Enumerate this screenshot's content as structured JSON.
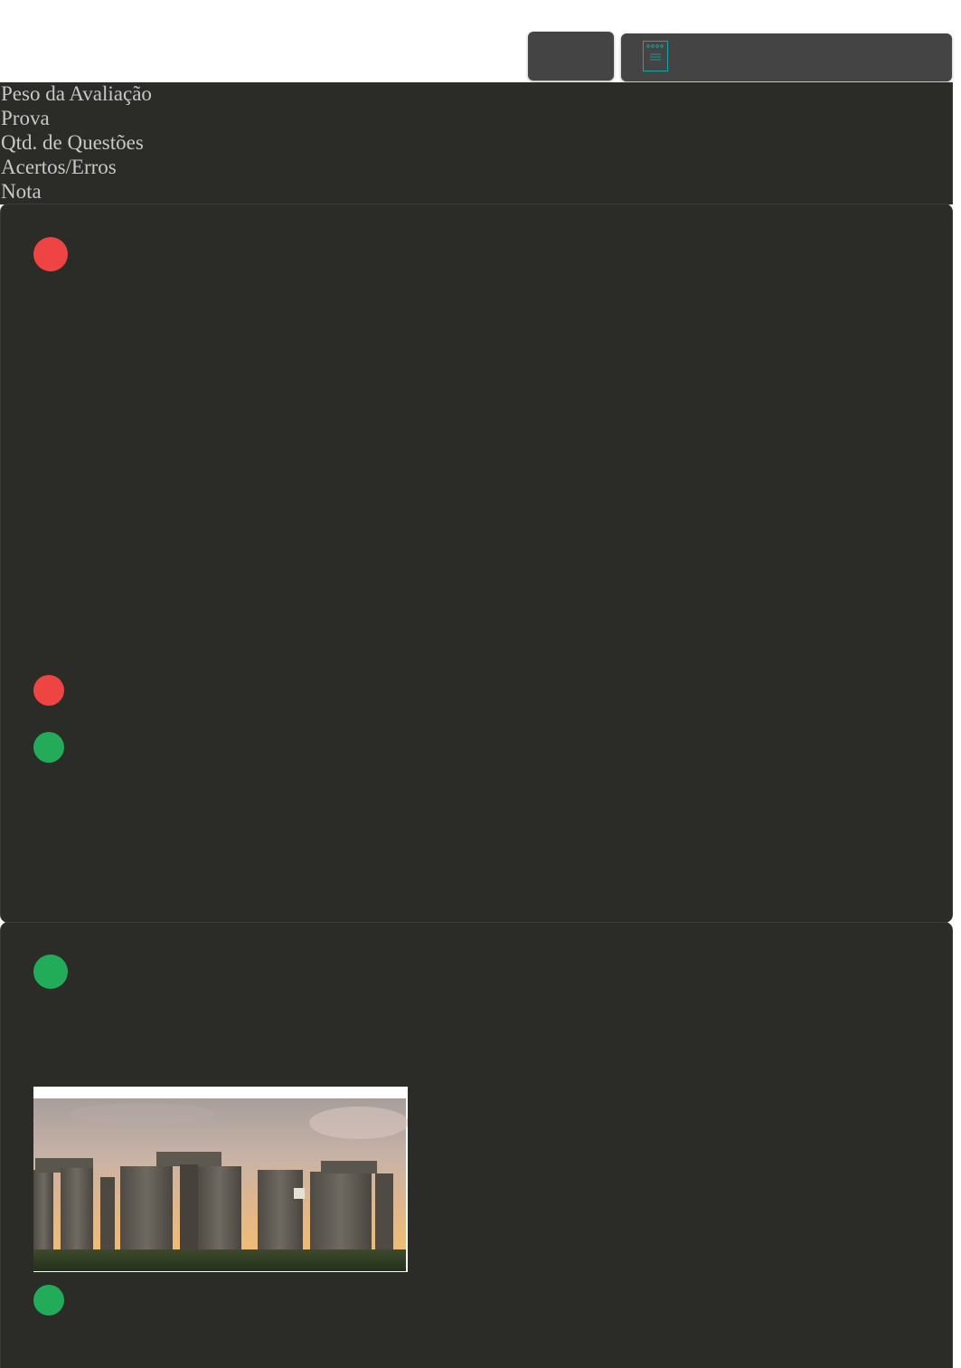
{
  "header": {
    "doc_icon": "document-icon"
  },
  "info": {
    "peso": "Peso da Avaliação",
    "prova": "Prova",
    "qtd": "Qtd. de Questões",
    "acertos": "Acertos/Erros",
    "nota": "Nota"
  },
  "colors": {
    "wrong": "#ef4444",
    "correct": "#22ab59",
    "card_bg": "#2b2b28",
    "button_bg": "#444444",
    "icon_accent": "#16a8a8"
  },
  "questions": [
    {
      "status": "wrong",
      "status_icon": "incorrect-indicator-icon",
      "alternatives_marks": [
        "wrong",
        "correct"
      ]
    },
    {
      "status": "correct",
      "status_icon": "correct-indicator-icon",
      "image": "stonehenge-image",
      "alternatives_marks": [
        "correct"
      ]
    }
  ]
}
